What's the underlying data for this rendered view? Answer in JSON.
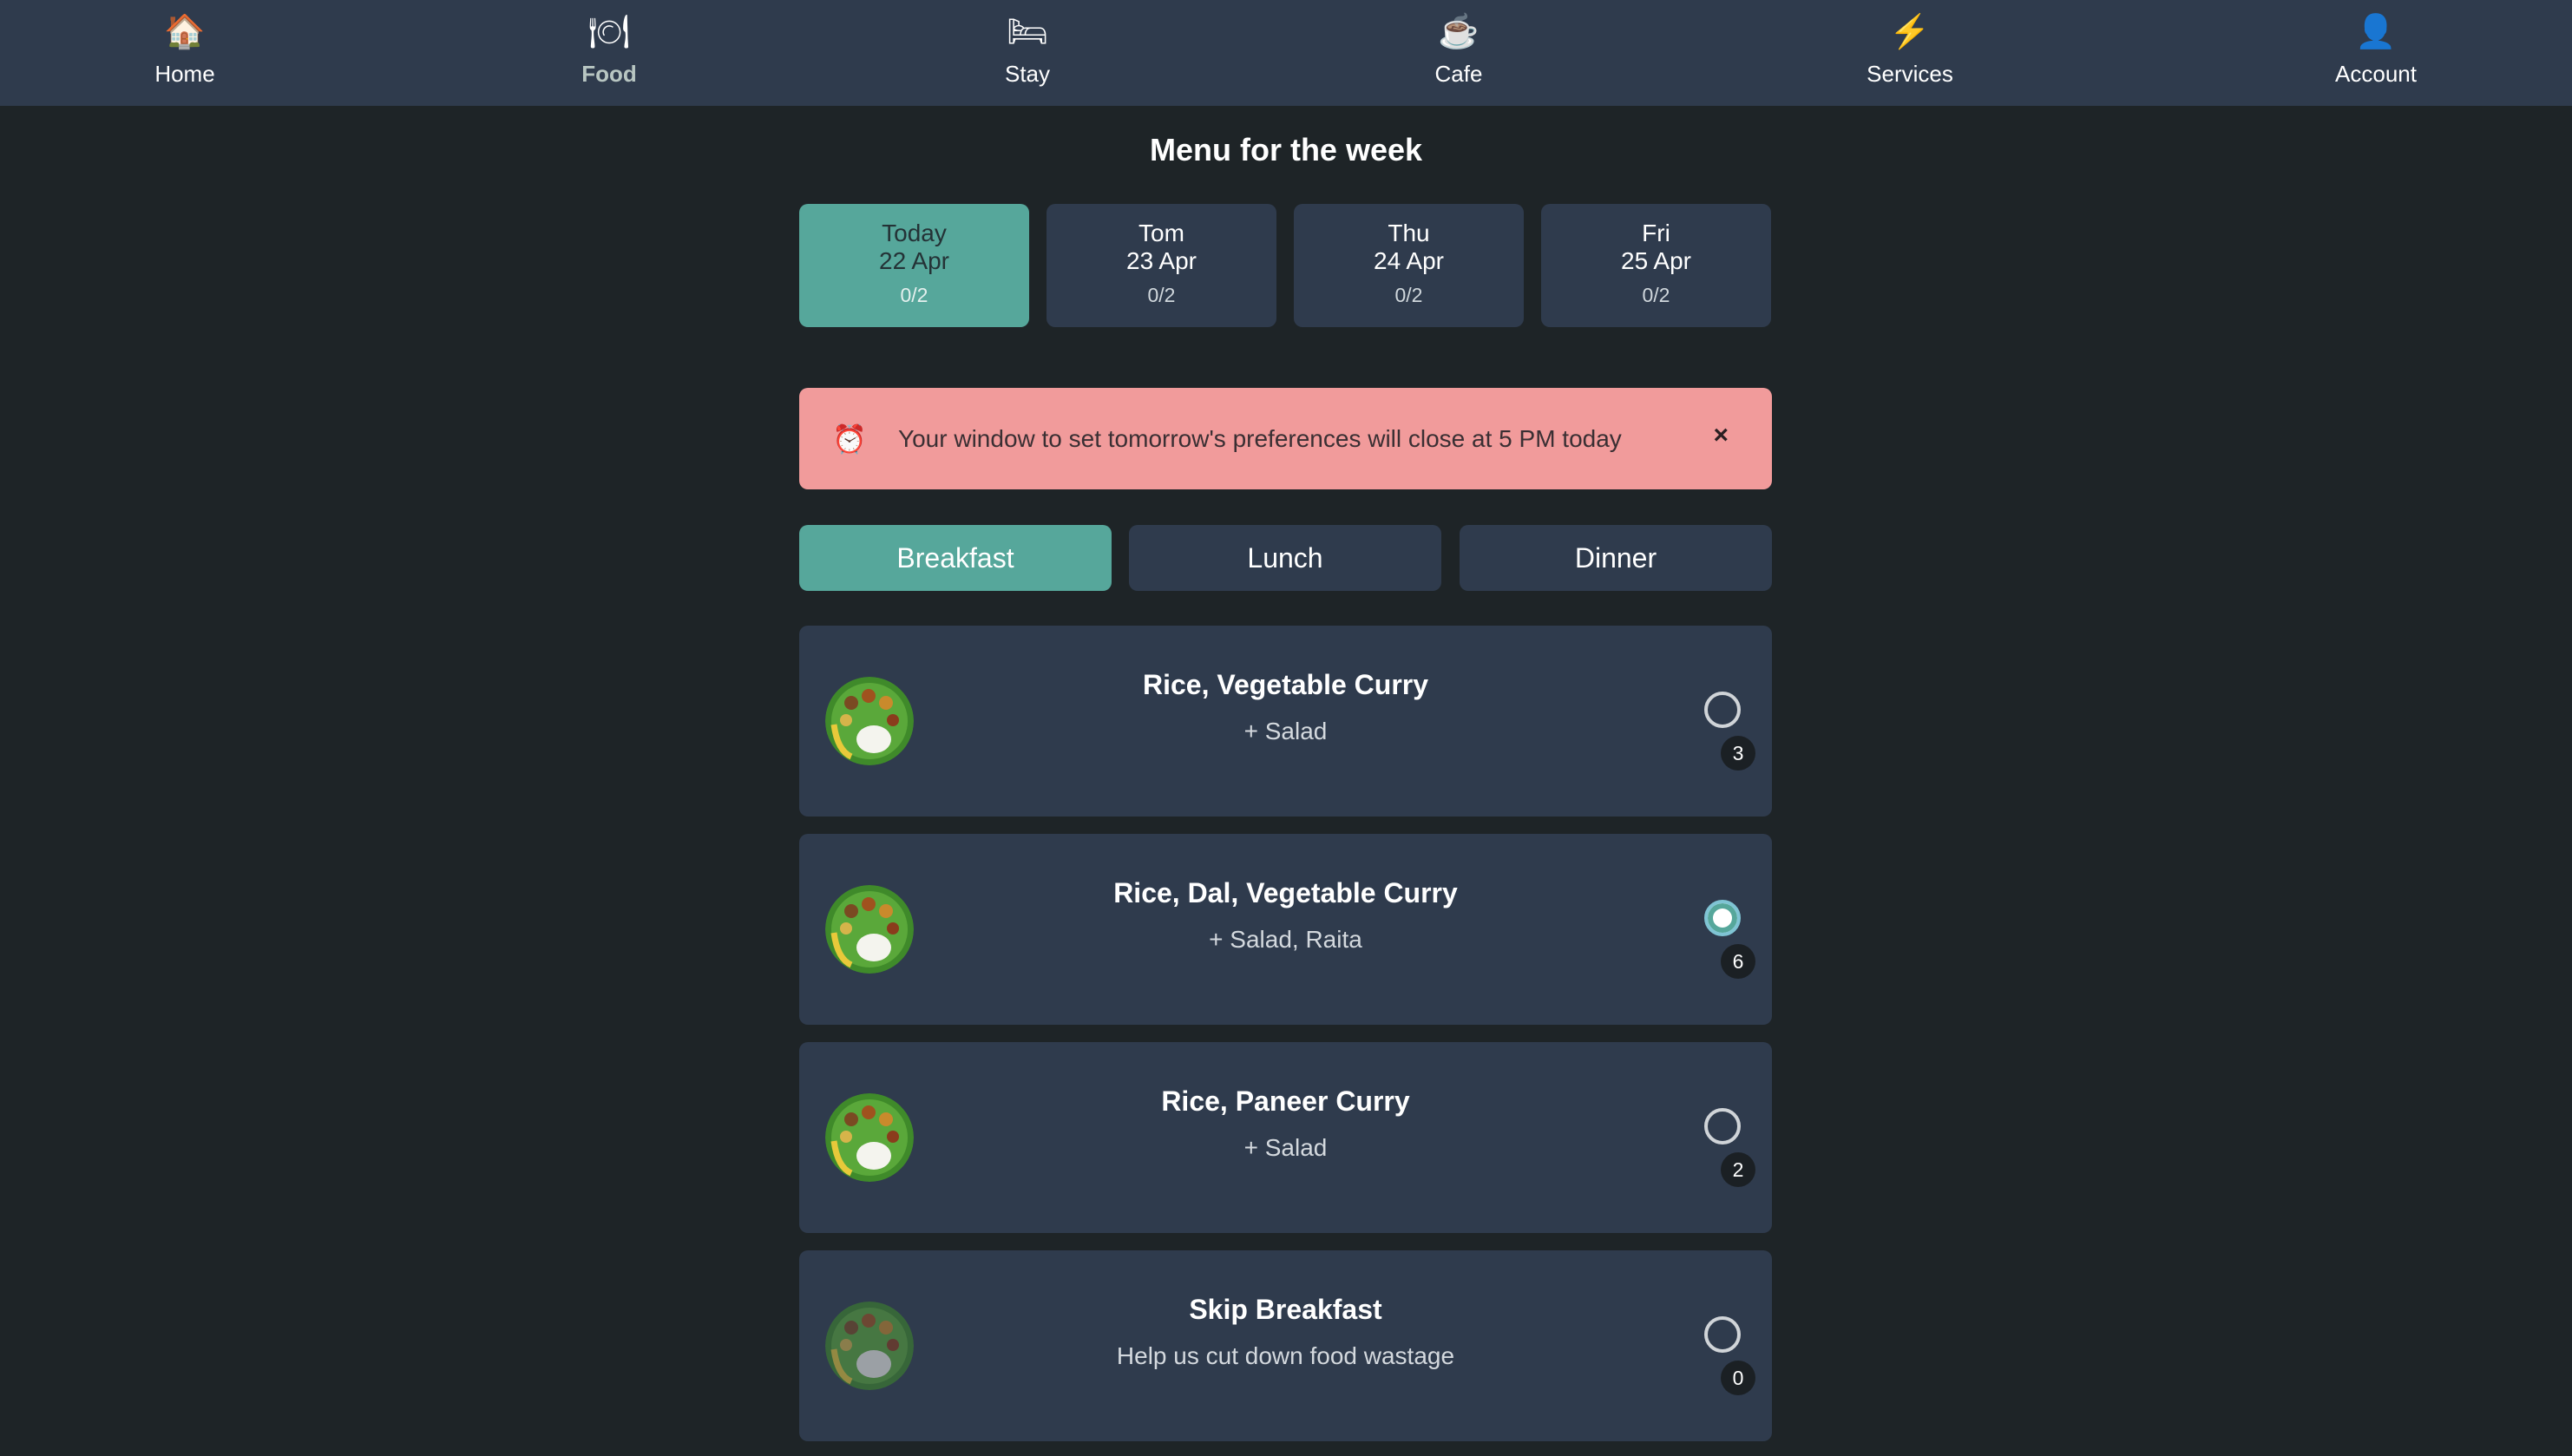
{
  "nav": {
    "items": [
      {
        "label": "Home",
        "icon": "🏠",
        "icon_name": "house-icon"
      },
      {
        "label": "Food",
        "icon": "🍽",
        "icon_name": "plate-icon"
      },
      {
        "label": "Stay",
        "icon": "🛏",
        "icon_name": "bed-icon"
      },
      {
        "label": "Cafe",
        "icon": "☕",
        "icon_name": "coffee-icon"
      },
      {
        "label": "Services",
        "icon": "⚡",
        "icon_name": "lightning-icon"
      },
      {
        "label": "Account",
        "icon": "👤",
        "icon_name": "user-icon"
      }
    ],
    "active": "Food"
  },
  "page": {
    "title": "Menu for the week"
  },
  "days": [
    {
      "name": "Today",
      "date": "22 Apr",
      "count": "0/2",
      "active": true
    },
    {
      "name": "Tom",
      "date": "23 Apr",
      "count": "0/2",
      "active": false
    },
    {
      "name": "Thu",
      "date": "24 Apr",
      "count": "0/2",
      "active": false
    },
    {
      "name": "Fri",
      "date": "25 Apr",
      "count": "0/2",
      "active": false
    }
  ],
  "alert": {
    "icon": "⏰",
    "text": "Your window to set tomorrow's preferences will close at 5 PM today",
    "close": "×"
  },
  "meals": {
    "tabs": [
      "Breakfast",
      "Lunch",
      "Dinner"
    ],
    "active": "Breakfast"
  },
  "menu_items": [
    {
      "name": "Rice, Vegetable Curry",
      "sub": "+ Salad",
      "count": "3",
      "selected": false
    },
    {
      "name": "Rice, Dal, Vegetable Curry",
      "sub": "+ Salad, Raita",
      "count": "6",
      "selected": true
    },
    {
      "name": "Rice, Paneer Curry",
      "sub": "+ Salad",
      "count": "2",
      "selected": false
    },
    {
      "name": "Skip Breakfast",
      "sub": "Help us cut down food wastage",
      "count": "0",
      "selected": false
    }
  ],
  "colors": {
    "background": "#1e2427",
    "panel": "#2f3b4d",
    "accent": "#56a79b",
    "alert": "#f19b9b"
  }
}
